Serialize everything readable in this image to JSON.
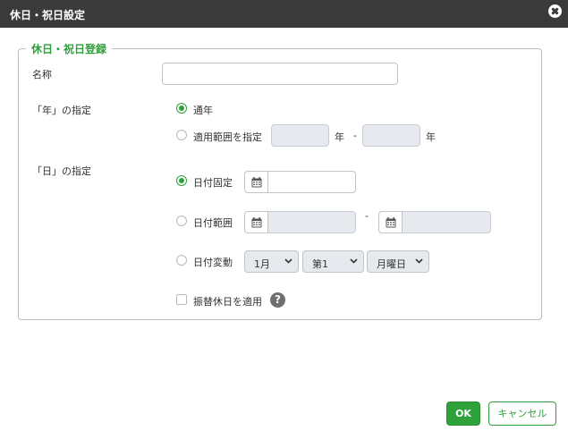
{
  "dialog": {
    "title": "休日・祝日設定"
  },
  "section": {
    "legend": "休日・祝日登録"
  },
  "name_field": {
    "label": "名称",
    "value": ""
  },
  "year_spec": {
    "label": "「年」の指定",
    "options": {
      "every_year": "通年",
      "range": "適用範囲を指定"
    },
    "selected": "every_year",
    "range_from": "",
    "range_to": "",
    "unit_label": "年",
    "separator": "-"
  },
  "day_spec": {
    "label": "「日」の指定",
    "options": {
      "fixed": "日付固定",
      "range": "日付範囲",
      "variable": "日付変動"
    },
    "selected": "fixed",
    "fixed_date": "",
    "range_from": "",
    "range_to": "",
    "range_separator": "-",
    "variable": {
      "month": "1月",
      "week": "第1",
      "weekday": "月曜日"
    }
  },
  "substitute_holiday": {
    "label": "振替休日を適用",
    "checked": false,
    "help_symbol": "?"
  },
  "buttons": {
    "ok": "OK",
    "cancel": "キャンセル"
  },
  "colors": {
    "accent": "#2ea13a",
    "titlebar": "#3a3a3a",
    "disabled_bg": "#e6e9ee"
  },
  "icons": {
    "close": "close-icon",
    "calendar": "calendar-icon",
    "help": "help-icon",
    "chevron": "chevron-down-icon"
  }
}
